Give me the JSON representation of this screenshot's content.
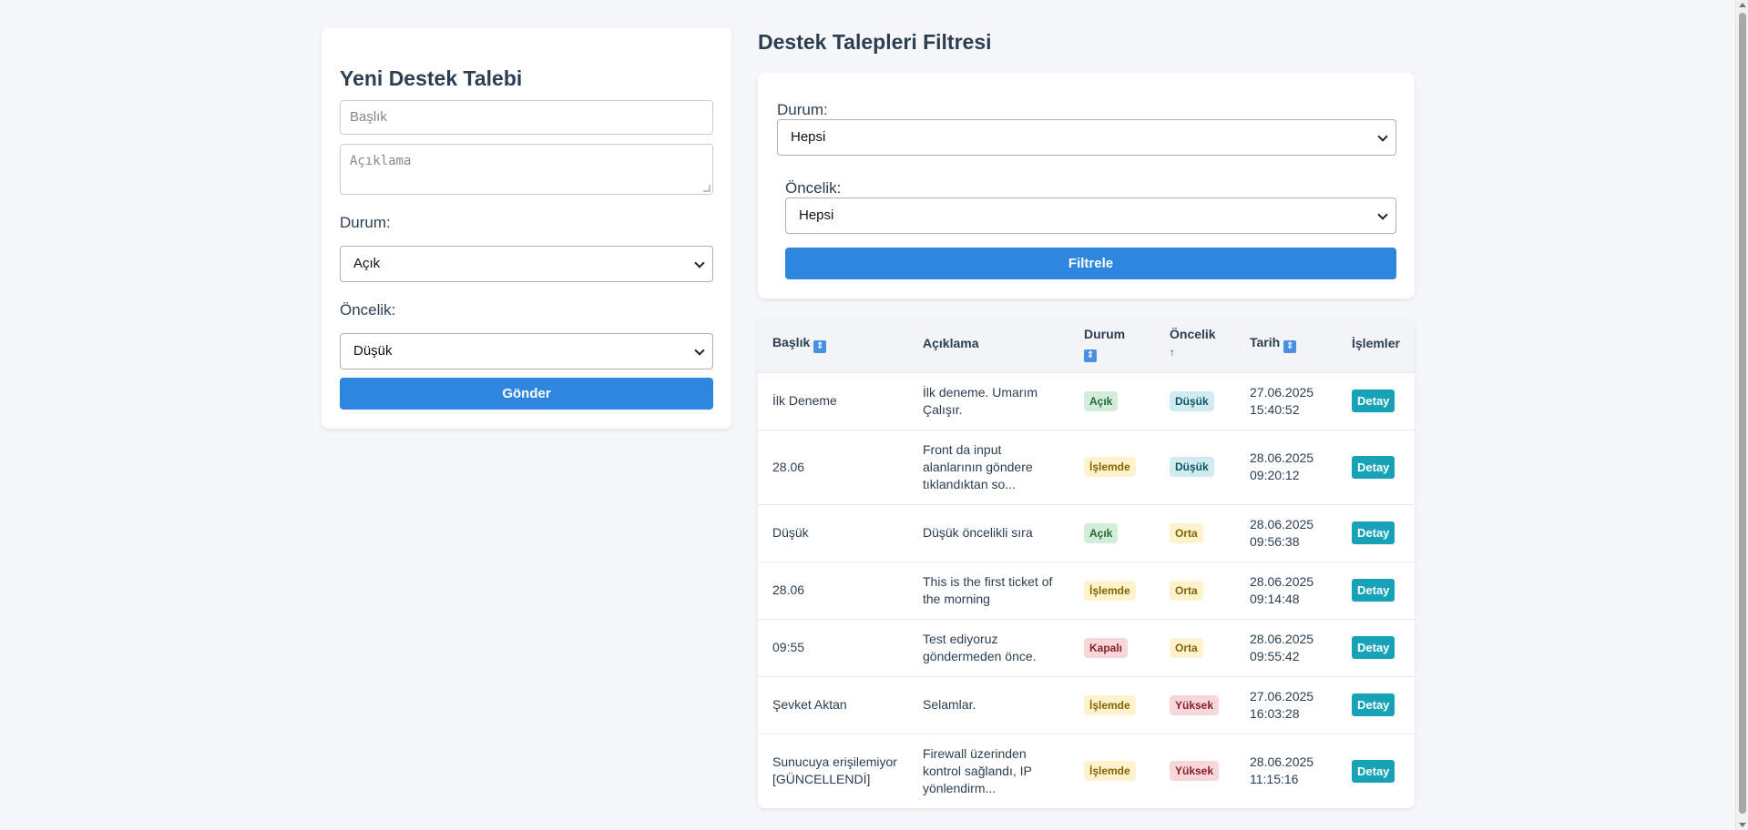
{
  "form": {
    "title": "Yeni Destek Talebi",
    "title_placeholder": "Başlık",
    "description_placeholder": "Açıklama",
    "status_label": "Durum:",
    "status_value": "Açık",
    "priority_label": "Öncelik:",
    "priority_value": "Düşük",
    "submit_label": "Gönder"
  },
  "filter": {
    "heading": "Destek Talepleri Filtresi",
    "status_label": "Durum:",
    "status_value": "Hepsi",
    "priority_label": "Öncelik:",
    "priority_value": "Hepsi",
    "button_label": "Filtrele"
  },
  "table": {
    "headers": {
      "title": "Başlık",
      "description": "Açıklama",
      "status": "Durum",
      "priority": "Öncelik",
      "priority_sort": "↑",
      "date": "Tarih",
      "actions": "İşlemler"
    },
    "sort_icon": "⇕",
    "rows": [
      {
        "title": "İlk Deneme",
        "description": "İlk deneme. Umarım Çalışır.",
        "status": "Açık",
        "priority": "Düşük",
        "date": "27.06.2025",
        "time": "15:40:52",
        "action": "Detay"
      },
      {
        "title": "28.06",
        "description": "Front da input alanlarının göndere tıklandıktan so...",
        "status": "İşlemde",
        "priority": "Düşük",
        "date": "28.06.2025",
        "time": "09:20:12",
        "action": "Detay"
      },
      {
        "title": "Düşük",
        "description": "Düşük öncelikli sıra",
        "status": "Açık",
        "priority": "Orta",
        "date": "28.06.2025",
        "time": "09:56:38",
        "action": "Detay"
      },
      {
        "title": "28.06",
        "description": "This is the first ticket of the morning",
        "status": "İşlemde",
        "priority": "Orta",
        "date": "28.06.2025",
        "time": "09:14:48",
        "action": "Detay"
      },
      {
        "title": "09:55",
        "description": "Test ediyoruz göndermeden önce.",
        "status": "Kapalı",
        "priority": "Orta",
        "date": "28.06.2025",
        "time": "09:55:42",
        "action": "Detay"
      },
      {
        "title": "Şevket Aktan",
        "description": "Selamlar.",
        "status": "İşlemde",
        "priority": "Yüksek",
        "date": "27.06.2025",
        "time": "16:03:28",
        "action": "Detay"
      },
      {
        "title": "Sunucuya erişilemiyor [GÜNCELLENDİ]",
        "description": "Firewall üzerinden kontrol sağlandı, IP yönlendirm...",
        "status": "İşlemde",
        "priority": "Yüksek",
        "date": "28.06.2025",
        "time": "11:15:16",
        "action": "Detay"
      }
    ]
  },
  "colors": {
    "primary": "#2e86de",
    "detail": "#17a2b8",
    "text": "#2c3e50",
    "background": "#f5f7fa"
  }
}
